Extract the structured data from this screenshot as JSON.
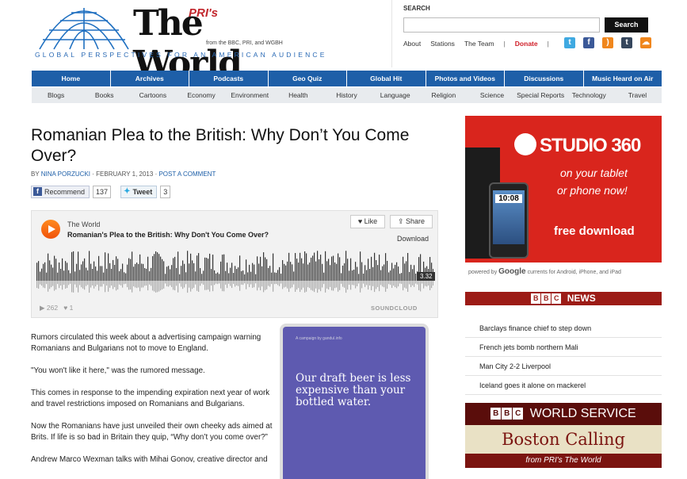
{
  "header": {
    "logo_pris": "PRI's",
    "logo_title": "The World",
    "logo_from": "from the BBC, PRI, and WGBH",
    "tagline": "GLOBAL PERSPECTIVES FOR AN AMERICAN AUDIENCE",
    "search_label": "SEARCH",
    "search_placeholder": "",
    "search_button": "Search",
    "links": [
      "About",
      "Stations",
      "The Team"
    ],
    "donate": "Donate",
    "social_icons": [
      "twitter-icon",
      "facebook-icon",
      "rss-icon",
      "tumblr-icon",
      "soundcloud-icon"
    ]
  },
  "nav_primary": [
    "Home",
    "Archives",
    "Podcasts",
    "Geo Quiz",
    "Global Hit",
    "Photos and Videos",
    "Discussions",
    "Music Heard on Air"
  ],
  "nav_secondary": [
    "Blogs",
    "Books",
    "Cartoons",
    "Economy",
    "Environment",
    "Health",
    "History",
    "Language",
    "Religion",
    "Science",
    "Special Reports",
    "Technology",
    "Travel"
  ],
  "article": {
    "title": "Romanian Plea to the British: Why Don’t You Come Over?",
    "byline_prefix": "BY",
    "author": "NINA PORZUCKI",
    "date": "FEBRUARY 1, 2013",
    "comment": "POST A COMMENT",
    "fb_label": "Recommend",
    "fb_count": "137",
    "tw_label": "Tweet",
    "tw_count": "3",
    "paragraphs": [
      "Rumors circulated this week about a advertising campaign warning Romanians and Bulgarians not to move to England.",
      "\"You won't like it here,\" was the rumored message.",
      "This comes in response to the impending expiration next year of work and travel restrictions imposed on Romanians and Bulgarians.",
      "Now the Romanians have just unveiled their own cheeky ads aimed at Brits. If life is so bad in Britain they quip, “Why don’t you come over?”",
      "Andrew Marco Wexman talks with Mihai Gonov, creative director and"
    ],
    "ad_small": "A campaign by gandul.info",
    "ad_big": "Our draft beer is less expensive than your bottled water."
  },
  "player": {
    "user": "The World",
    "track": "Romanian's Plea to the British: Why Don't You Come Over?",
    "like": "Like",
    "share": "Share",
    "download": "Download",
    "duration": "3.32",
    "plays": "262",
    "likes": "1",
    "brand": "SOUNDCLOUD"
  },
  "sidebar": {
    "studio_title": "STUDIO 360",
    "studio_sub1": "on your tablet",
    "studio_sub2": "or phone now!",
    "studio_cta": "free download",
    "phone_time": "10:08",
    "powered_by": "powered by",
    "google": "Google",
    "currents": "currents for Android, iPhone, and iPad",
    "bbc_news_label": "NEWS",
    "bbc_headlines": [
      "Barclays finance chief to step down",
      "French jets bomb northern Mali",
      "Man City 2-2 Liverpool",
      "Iceland goes it alone on mackerel"
    ],
    "ws_label": "WORLD SERVICE",
    "ws_title": "Boston Calling",
    "ws_from": "from PRI's The World"
  },
  "colors": {
    "nav_blue": "#1e5fa8",
    "donate_red": "#d0202a",
    "bbc_red": "#9c1b16",
    "studio_red": "#d9251d"
  }
}
